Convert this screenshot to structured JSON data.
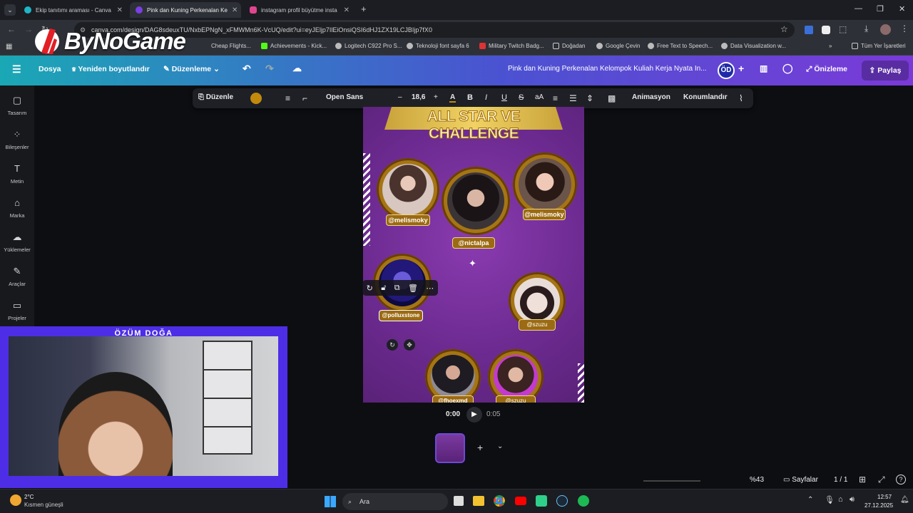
{
  "browser": {
    "tabs": [
      {
        "title": "Ekip tanıtımı araması - Canva",
        "color": "#1fb5c7"
      },
      {
        "title": "Pink dan Kuning Perkenalan Ke",
        "color": "#7b3fe4"
      },
      {
        "title": "instagram profil büyütme insta",
        "color": "#e0458f"
      }
    ],
    "url": "canva.com/design/DAG8sdeuxTU/NxbEPNgN_xFMWMn6K-VcUQ/edit?ui=eyJEljp7IlEiOnsiQSI6dHJ1ZX19LCJBIjp7fX0",
    "bookmarks": [
      "Cheap Flights...",
      "Achievements - Kick...",
      "Logitech C922 Pro S...",
      "Teknoloji font sayfa 6",
      "Military Twitch Badg...",
      "Doğadan",
      "Google Çevin",
      "Free Text to Speech...",
      "Data Visualization w..."
    ],
    "bookmarks_all": "Tüm Yer İşaretleri",
    "logo_text": "ByNoGame"
  },
  "canva": {
    "menu": "Dosya",
    "resize": "Yeniden boyutlandır",
    "edit": "Düzenleme",
    "doc_title": "Pink dan Kuning Perkenalan Kelompok Kuliah Kerja Nyata In...",
    "avatar": "ÖD",
    "preview": "Önizleme",
    "share": "Paylaş",
    "nav": [
      "Tasarım",
      "Bileşenler",
      "Metin",
      "Marka",
      "Yüklemeler",
      "Araçlar",
      "Projeler"
    ]
  },
  "toolbar": {
    "edit": "Düzenle",
    "font": "Open Sans",
    "minus": "–",
    "size": "18,6",
    "plus": "+",
    "bold": "B",
    "italic": "I",
    "underline": "U",
    "strike": "S",
    "case": "aA",
    "animate": "Animasyon",
    "position": "Konumlandır",
    "text_color": "#c28a0c"
  },
  "design": {
    "title": "ALL STAR VE CHALLENGE",
    "names": [
      "@melismoky",
      "@nictalpa",
      "@melismoky",
      "@polluxstone",
      "@szuzu",
      "@fhoexmd",
      "@szuzu"
    ]
  },
  "player": {
    "current": "0:00",
    "total": "0:05"
  },
  "pagination": {
    "zoom": "%43",
    "pages_label": "Sayfalar",
    "pages": "1 / 1"
  },
  "taskbar": {
    "temp": "2°C",
    "weather": "Kısmen güneşli",
    "search": "Ara",
    "time": "12:57",
    "date": "27.12.2025"
  },
  "webcam": {
    "name": "ÖZÜM DOĞA"
  }
}
